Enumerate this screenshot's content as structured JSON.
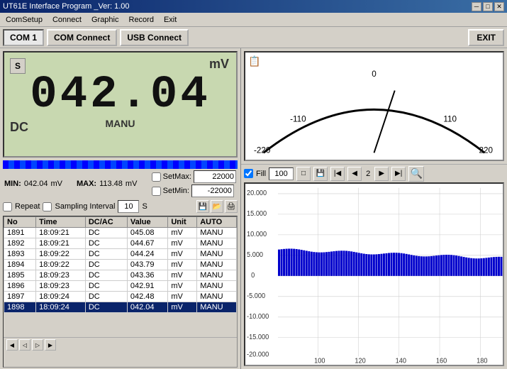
{
  "titleBar": {
    "title": "UT61E Interface Program  _Ver: 1.00",
    "minBtn": "─",
    "maxBtn": "□",
    "closeBtn": "✕"
  },
  "menuBar": {
    "items": [
      "ComSetup",
      "Connect",
      "Graphic",
      "Record",
      "Exit"
    ]
  },
  "toolbar": {
    "com1Label": "COM 1",
    "comConnectLabel": "COM Connect",
    "usbConnectLabel": "USB Connect",
    "exitLabel": "EXIT"
  },
  "display": {
    "modeLabel": "S",
    "unit": "mV",
    "mode": "DC",
    "value": "042.04",
    "label": "MANU"
  },
  "minmax": {
    "minLabel": "MIN:",
    "minValue": "042.04",
    "minUnit": "mV",
    "maxLabel": "MAX:",
    "maxValue": "113.48",
    "maxUnit": "mV"
  },
  "setpoints": {
    "setMaxLabel": "SetMax:",
    "setMaxValue": "22000",
    "setMinLabel": "SetMin:",
    "setMinValue": "-22000"
  },
  "controls": {
    "repeatLabel": "Repeat",
    "samplingLabel": "Sampling Interval",
    "intervalValue": "10",
    "unitS": "S"
  },
  "tableHeaders": [
    "No",
    "Time",
    "DC/AC",
    "Value",
    "Unit",
    "AUTO"
  ],
  "tableRows": [
    {
      "no": "1891",
      "time": "18:09:21",
      "dcac": "DC",
      "value": "045.08",
      "unit": "mV",
      "auto": "MANU"
    },
    {
      "no": "1892",
      "time": "18:09:21",
      "dcac": "DC",
      "value": "044.67",
      "unit": "mV",
      "auto": "MANU"
    },
    {
      "no": "1893",
      "time": "18:09:22",
      "dcac": "DC",
      "value": "044.24",
      "unit": "mV",
      "auto": "MANU"
    },
    {
      "no": "1894",
      "time": "18:09:22",
      "dcac": "DC",
      "value": "043.79",
      "unit": "mV",
      "auto": "MANU"
    },
    {
      "no": "1895",
      "time": "18:09:23",
      "dcac": "DC",
      "value": "043.36",
      "unit": "mV",
      "auto": "MANU"
    },
    {
      "no": "1896",
      "time": "18:09:23",
      "dcac": "DC",
      "value": "042.91",
      "unit": "mV",
      "auto": "MANU"
    },
    {
      "no": "1897",
      "time": "18:09:24",
      "dcac": "DC",
      "value": "042.48",
      "unit": "mV",
      "auto": "MANU"
    },
    {
      "no": "1898",
      "time": "18:09:24",
      "dcac": "DC",
      "value": "042.04",
      "unit": "mV",
      "auto": "MANU"
    }
  ],
  "selectedRow": 7,
  "gauge": {
    "labels": [
      "-220",
      "-110",
      "0",
      "110",
      "220"
    ],
    "currentValue": 42.04,
    "maxValue": 220
  },
  "chart": {
    "fillLabel": "Fill",
    "fillValue": "100",
    "pageLabel": "2",
    "yAxisLabels": [
      "20.000",
      "15.000",
      "10.000",
      "5.000",
      "0",
      "-5.000",
      "-10.000",
      "-15.000",
      "-20.000"
    ],
    "xAxisLabels": [
      "100",
      "120",
      "140",
      "160",
      "180"
    ],
    "colors": {
      "barColor": "#0000cc",
      "gridColor": "#cccccc"
    }
  }
}
